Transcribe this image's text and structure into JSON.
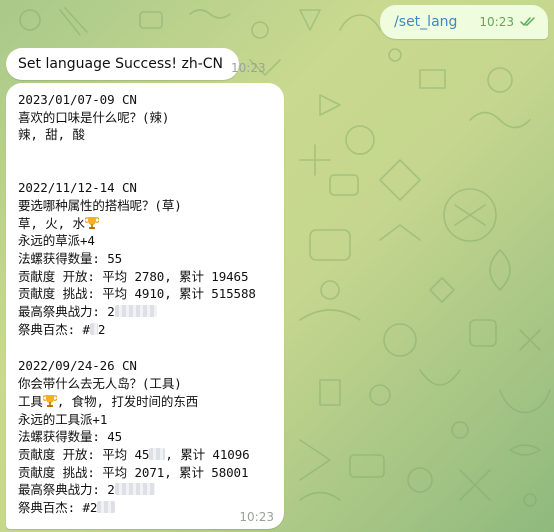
{
  "outgoing": {
    "text": "/set_lang",
    "time": "10:23",
    "status_icon": "double-check-icon"
  },
  "reply1": {
    "text": "Set language Success! zh-CN",
    "time": "10:23"
  },
  "reply2": {
    "time": "10:23",
    "events": [
      {
        "date": "2023/01/07-09 CN",
        "lines": [
          "喜欢的口味是什么呢？(辣)",
          "辣, 甜, 酸"
        ]
      },
      {
        "date": "2022/11/12-14 CN",
        "question": "要选哪种属性的搭档呢？(草)",
        "choices": "草, 火, 水",
        "team": "永远的草派+4",
        "shells": "法螺获得数量: 55",
        "contrib_open": "贡献度 开放: 平均 2780, 累计 19465",
        "contrib_challenge": "贡献度 挑战: 平均 4910, 累计 515588",
        "max_power_prefix": "最高祭典战力: 2",
        "top100_prefix": "祭典百杰: #",
        "top100_suffix": "2"
      },
      {
        "date": "2022/09/24-26 CN",
        "question": "你会带什么去无人岛？(工具)",
        "choices_prefix": "工具",
        "choices_suffix": ", 食物, 打发时间的东西",
        "team": "永远的工具派+1",
        "shells": "法螺获得数量: 45",
        "contrib_open_prefix": "贡献度 开放: 平均 45",
        "contrib_open_suffix": ", 累计 41096",
        "contrib_challenge": "贡献度 挑战: 平均 2071, 累计 58001",
        "max_power_prefix": "最高祭典战力: 2",
        "top100_prefix": "祭典百杰: #2"
      }
    ]
  },
  "colors": {
    "outgoing_bubble": "#effdde",
    "incoming_bubble": "#ffffff",
    "link": "#3e88c7",
    "outgoing_time": "#5fa95a"
  }
}
